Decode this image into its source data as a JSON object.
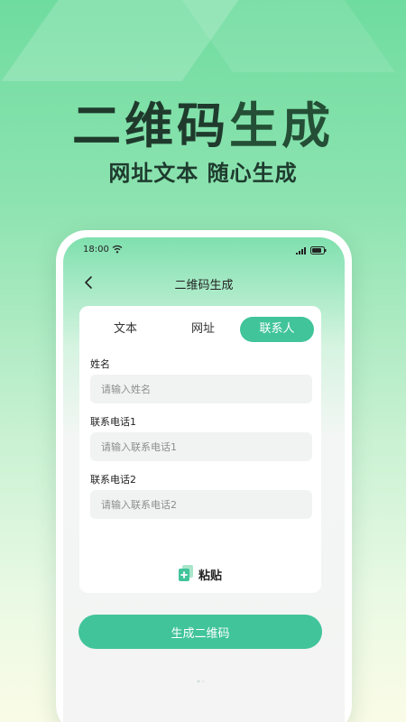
{
  "promo": {
    "headline_part1": "二维码",
    "headline_part2": "生成",
    "subheadline": "网址文本 随心生成"
  },
  "status_bar": {
    "time": "18:00",
    "icons": [
      "wifi-icon",
      "signal-icon",
      "battery-icon"
    ]
  },
  "nav": {
    "back_icon": "chevron-left-icon",
    "title": "二维码生成"
  },
  "tabs": [
    {
      "label": "文本",
      "active": false
    },
    {
      "label": "网址",
      "active": false
    },
    {
      "label": "联系人",
      "active": true
    }
  ],
  "form": {
    "name": {
      "label": "姓名",
      "placeholder": "请输入姓名",
      "value": ""
    },
    "phone1": {
      "label": "联系电话1",
      "placeholder": "请输入联系电话1",
      "value": ""
    },
    "phone2": {
      "label": "联系电话2",
      "placeholder": "请输入联系电话2",
      "value": ""
    }
  },
  "paste": {
    "label": "粘贴",
    "icon": "paste-icon"
  },
  "generate_button": {
    "label": "生成二维码"
  },
  "colors": {
    "accent": "#41c49a",
    "headline_dark": "#1f3a2d",
    "background_top": "#6fdc9f",
    "background_bottom": "#fafbe6"
  }
}
